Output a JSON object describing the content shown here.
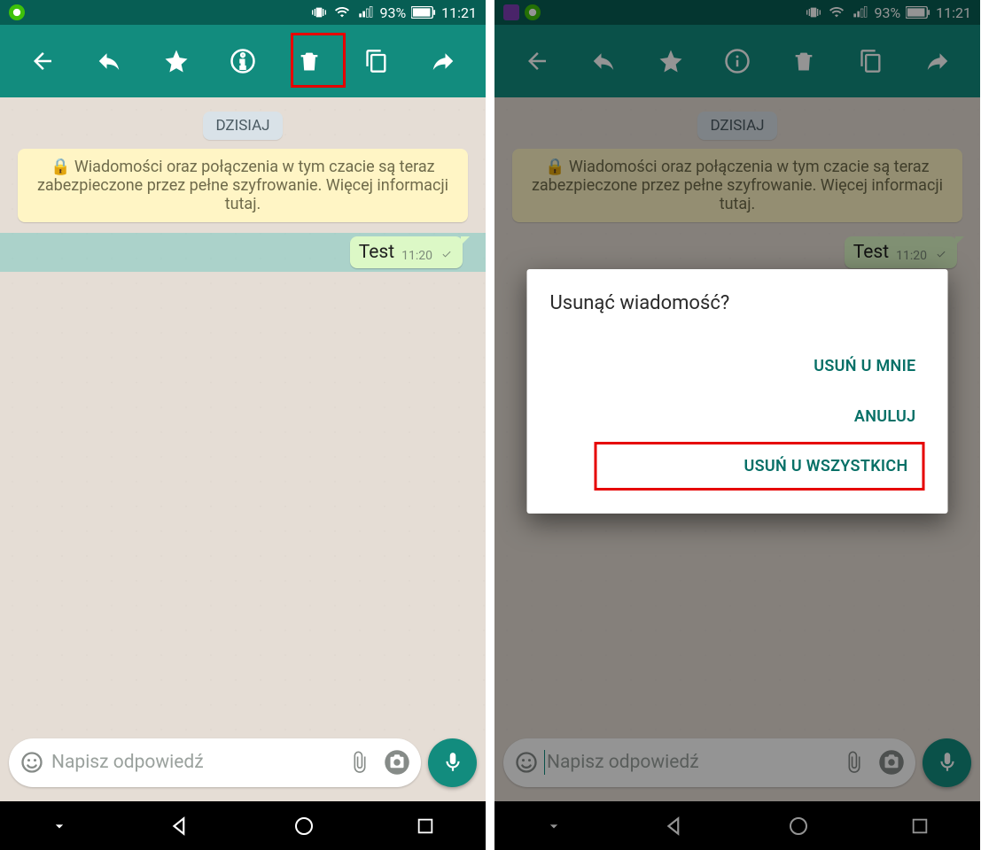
{
  "status": {
    "time": "11:21",
    "battery": "93%"
  },
  "chat": {
    "date": "DZISIAJ",
    "encryption": "Wiadomości oraz połączenia w tym czacie są teraz zabezpieczone przez pełne szyfrowanie. Więcej informacji tutaj.",
    "message_text": "Test",
    "message_time": "11:20",
    "input_placeholder": "Napisz odpowiedź"
  },
  "dialog": {
    "title": "Usunąć wiadomość?",
    "delete_for_me": "USUŃ U MNIE",
    "cancel": "ANULUJ",
    "delete_for_all": "USUŃ U WSZYSTKICH"
  }
}
